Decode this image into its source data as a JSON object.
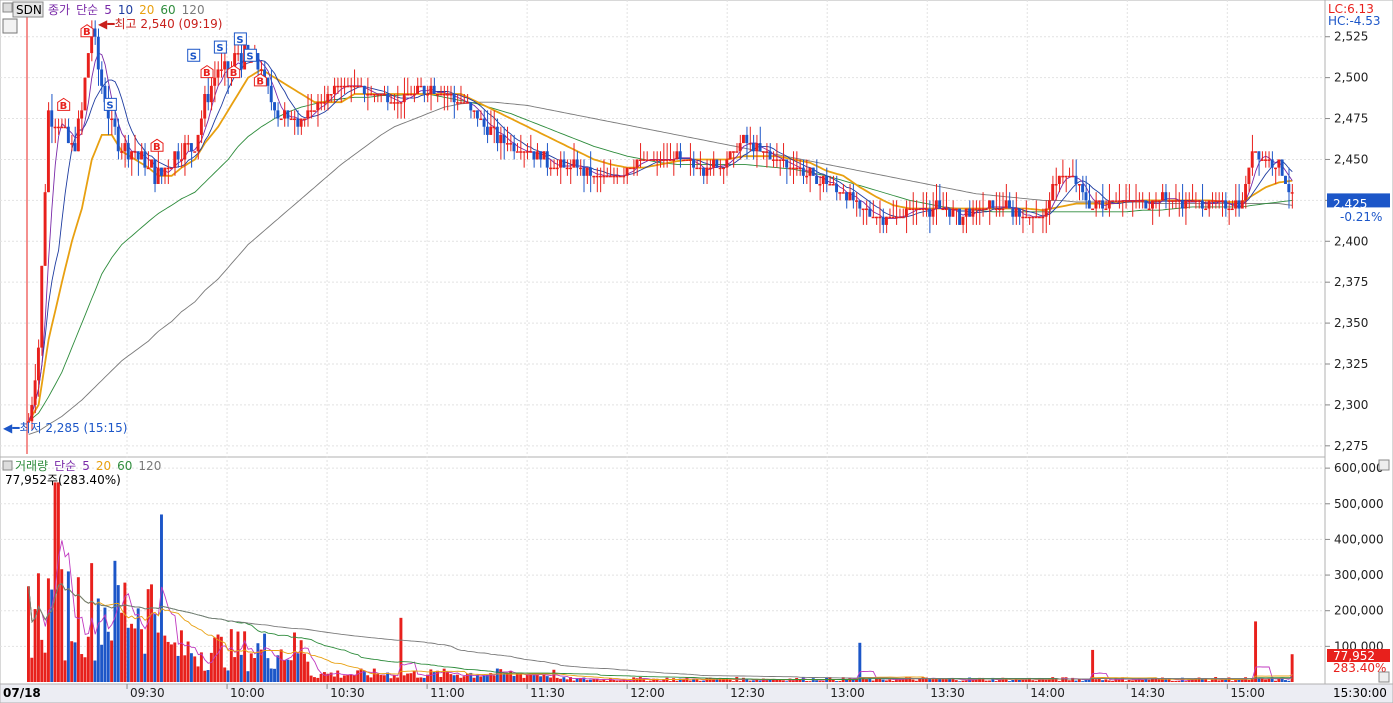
{
  "header": {
    "symbol": "SDN",
    "price_legend": [
      "종가",
      "단순",
      "5",
      "10",
      "20",
      "60",
      "120"
    ],
    "max_marker": "최고 2,540 (09:19)",
    "min_marker": "최저 2,285 (15:15)",
    "lc": "LC:6.13",
    "hc": "HC:-4.53",
    "current_price": "2,425",
    "current_change": "-0.21%"
  },
  "volume_header": {
    "legend": [
      "거래량",
      "단순",
      "5",
      "20",
      "60",
      "120"
    ],
    "current": "77,952주(283.40%)",
    "current_badge": "77,952",
    "current_pct": "283.40%"
  },
  "x_axis": {
    "date": "07/18",
    "ticks": [
      "09:30",
      "10:00",
      "10:30",
      "11:00",
      "11:30",
      "12:00",
      "12:30",
      "13:00",
      "13:30",
      "14:00",
      "14:30",
      "15:00"
    ],
    "right_label": "15:30:00"
  },
  "colors": {
    "up": "#e8201c",
    "down": "#1c56c8",
    "ma5": "#7a2aa8",
    "ma10": "#1e3ca0",
    "ma20": "#e8a010",
    "ma60": "#2e8c3c",
    "ma120": "#7a7a7a"
  },
  "chart_data": [
    {
      "type": "candlestick",
      "title": "SDN",
      "ylim": [
        2270,
        2545
      ],
      "y_ticks": [
        2275,
        2300,
        2325,
        2350,
        2375,
        2400,
        2425,
        2450,
        2475,
        2500,
        2525
      ],
      "y_tick_labels": [
        "2,275",
        "2,300",
        "2,325",
        "2,350",
        "2,375",
        "2,400",
        "2,425",
        "2,450",
        "2,475",
        "2,500",
        "2,525"
      ],
      "high": 2540,
      "low": 2285,
      "last": 2425,
      "close_path": {
        "x": [
          "09:00",
          "09:03",
          "09:06",
          "09:10",
          "09:13",
          "09:16",
          "09:19",
          "09:22",
          "09:25",
          "09:28",
          "09:32",
          "09:36",
          "09:39",
          "09:43",
          "09:46",
          "09:50",
          "09:53",
          "09:57",
          "10:00",
          "10:03",
          "10:06",
          "10:10",
          "10:14",
          "10:18",
          "10:22",
          "10:26",
          "10:30",
          "10:34",
          "10:38",
          "10:42",
          "10:46",
          "10:50",
          "10:55",
          "11:00",
          "11:05",
          "11:10",
          "11:15",
          "11:20",
          "11:25",
          "11:30",
          "11:35",
          "11:40",
          "11:45",
          "11:50",
          "11:55",
          "12:00",
          "12:05",
          "12:10",
          "12:15",
          "12:20",
          "12:25",
          "12:30",
          "12:35",
          "12:40",
          "12:45",
          "12:50",
          "12:55",
          "13:00",
          "13:05",
          "13:10",
          "13:15",
          "13:20",
          "13:25",
          "13:30",
          "13:35",
          "13:40",
          "13:45",
          "13:50",
          "13:55",
          "14:00",
          "14:05",
          "14:10",
          "14:15",
          "14:20",
          "14:25",
          "14:30",
          "14:35",
          "14:40",
          "14:45",
          "14:50",
          "14:55",
          "15:00",
          "15:05",
          "15:08",
          "15:12",
          "15:16",
          "15:20"
        ],
        "values": [
          2290,
          2335,
          2480,
          2470,
          2455,
          2480,
          2530,
          2495,
          2470,
          2460,
          2455,
          2445,
          2440,
          2450,
          2455,
          2460,
          2485,
          2505,
          2500,
          2515,
          2510,
          2505,
          2480,
          2475,
          2475,
          2480,
          2490,
          2495,
          2495,
          2490,
          2490,
          2485,
          2490,
          2495,
          2490,
          2485,
          2475,
          2465,
          2460,
          2455,
          2450,
          2445,
          2445,
          2440,
          2440,
          2445,
          2450,
          2450,
          2450,
          2445,
          2445,
          2450,
          2460,
          2455,
          2450,
          2445,
          2440,
          2435,
          2430,
          2420,
          2415,
          2415,
          2420,
          2420,
          2420,
          2415,
          2420,
          2420,
          2420,
          2415,
          2415,
          2440,
          2435,
          2420,
          2425,
          2425,
          2425,
          2425,
          2425,
          2425,
          2425,
          2420,
          2425,
          2455,
          2450,
          2445,
          2425
        ]
      },
      "ma20": [
        2290,
        2300,
        2340,
        2375,
        2400,
        2420,
        2450,
        2465,
        2465,
        2455,
        2450,
        2445,
        2440,
        2440,
        2445,
        2450,
        2460,
        2470,
        2480,
        2490,
        2500,
        2505,
        2500,
        2495,
        2490,
        2485,
        2485,
        2485,
        2490,
        2490,
        2490,
        2490,
        2490,
        2490,
        2490,
        2490,
        2485,
        2480,
        2475,
        2470,
        2465,
        2460,
        2455,
        2450,
        2447,
        2445,
        2445,
        2447,
        2449,
        2450,
        2450,
        2450,
        2452,
        2452,
        2452,
        2450,
        2448,
        2443,
        2440,
        2433,
        2427,
        2422,
        2420,
        2420,
        2420,
        2420,
        2420,
        2420,
        2420,
        2420,
        2419,
        2421,
        2423,
        2423,
        2423,
        2424,
        2425,
        2425,
        2425,
        2425,
        2425,
        2424,
        2424,
        2428,
        2433,
        2436,
        2437
      ],
      "ma60": [
        2290,
        2295,
        2305,
        2320,
        2335,
        2350,
        2365,
        2380,
        2390,
        2398,
        2405,
        2412,
        2417,
        2422,
        2426,
        2430,
        2436,
        2444,
        2450,
        2458,
        2464,
        2470,
        2475,
        2479,
        2482,
        2484,
        2486,
        2487,
        2488,
        2488,
        2489,
        2489,
        2490,
        2490,
        2488,
        2486,
        2484,
        2481,
        2478,
        2474,
        2470,
        2466,
        2462,
        2458,
        2455,
        2452,
        2450,
        2448,
        2447,
        2447,
        2447,
        2447,
        2447,
        2446,
        2445,
        2444,
        2442,
        2440,
        2437,
        2434,
        2431,
        2428,
        2425,
        2423,
        2421,
        2420,
        2419,
        2418,
        2418,
        2418,
        2418,
        2418,
        2418,
        2418,
        2418,
        2418,
        2419,
        2419,
        2420,
        2421,
        2421,
        2421,
        2421,
        2422,
        2423,
        2424,
        2425
      ],
      "ma120": [
        2282,
        2284,
        2288,
        2293,
        2298,
        2303,
        2309,
        2315,
        2321,
        2327,
        2333,
        2339,
        2345,
        2351,
        2357,
        2363,
        2370,
        2377,
        2384,
        2391,
        2398,
        2405,
        2412,
        2419,
        2426,
        2433,
        2440,
        2447,
        2453,
        2459,
        2465,
        2470,
        2474,
        2478,
        2482,
        2484,
        2485,
        2485,
        2484,
        2483,
        2481,
        2479,
        2477,
        2475,
        2473,
        2471,
        2469,
        2467,
        2465,
        2463,
        2461,
        2459,
        2457,
        2455,
        2453,
        2451,
        2449,
        2447,
        2445,
        2443,
        2441,
        2439,
        2437,
        2435,
        2433,
        2431,
        2429,
        2428,
        2427,
        2426,
        2425,
        2425,
        2424,
        2424,
        2424,
        2424,
        2424,
        2423,
        2423,
        2423,
        2423,
        2423,
        2423,
        2423,
        2423,
        2423,
        2422
      ]
    },
    {
      "type": "bar",
      "title": "거래량",
      "ylim": [
        0,
        620000
      ],
      "y_ticks": [
        100000,
        200000,
        300000,
        400000,
        500000,
        600000
      ],
      "y_tick_labels": [
        "100,000",
        "200,000",
        "300,000",
        "400,000",
        "500,000",
        "600,000"
      ],
      "last": 77952
    }
  ]
}
